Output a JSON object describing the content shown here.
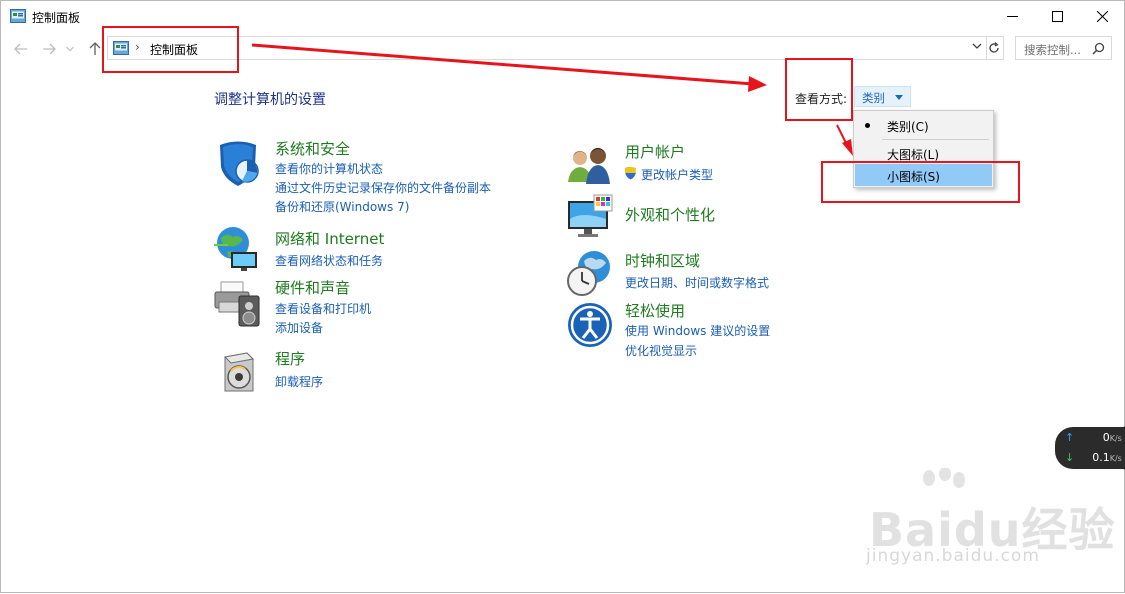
{
  "window": {
    "title": "控制面板"
  },
  "address": {
    "separator": "›",
    "path": "控制面板",
    "search_placeholder": "搜索控制..."
  },
  "main": {
    "title": "调整计算机的设置",
    "view_by_label": "查看方式:",
    "view_by_value": "类别"
  },
  "categories": [
    {
      "title": "系统和安全",
      "icon": "shield-icon",
      "links": [
        "查看你的计算机状态",
        "通过文件历史记录保存你的文件备份副本",
        "备份和还原(Windows 7)"
      ]
    },
    {
      "title": "网络和 Internet",
      "icon": "network-globe-icon",
      "links": [
        "查看网络状态和任务"
      ]
    },
    {
      "title": "硬件和声音",
      "icon": "printer-speaker-icon",
      "links": [
        "查看设备和打印机",
        "添加设备"
      ]
    },
    {
      "title": "程序",
      "icon": "programs-disc-icon",
      "links": [
        "卸载程序"
      ]
    },
    {
      "title": "用户帐户",
      "icon": "users-icon",
      "links": [
        "更改帐户类型"
      ]
    },
    {
      "title": "外观和个性化",
      "icon": "monitor-palette-icon",
      "links": []
    },
    {
      "title": "时钟和区域",
      "icon": "clock-globe-icon",
      "links": [
        "更改日期、时间或数字格式"
      ]
    },
    {
      "title": "轻松使用",
      "icon": "ease-of-access-icon",
      "links": [
        "使用 Windows 建议的设置",
        "优化视觉显示"
      ]
    }
  ],
  "view_menu": {
    "items": [
      {
        "label": "类别(C)",
        "selected": true
      },
      {
        "label": "大图标(L)",
        "selected": false
      },
      {
        "label": "小图标(S)",
        "selected": false,
        "highlighted": true
      }
    ]
  },
  "speed_widget": {
    "up_value": "0",
    "up_unit": "K/s",
    "down_value": "0.1",
    "down_unit": "K/s"
  },
  "watermark": {
    "brand": "Baidu经验",
    "url": "jingyan.baidu.com"
  },
  "colors": {
    "annotation": "#e8141c",
    "category_title": "#1e7c1e",
    "link": "#1a5fb4",
    "page_title": "#1e3287",
    "menu_highlight": "#91c9f7"
  }
}
